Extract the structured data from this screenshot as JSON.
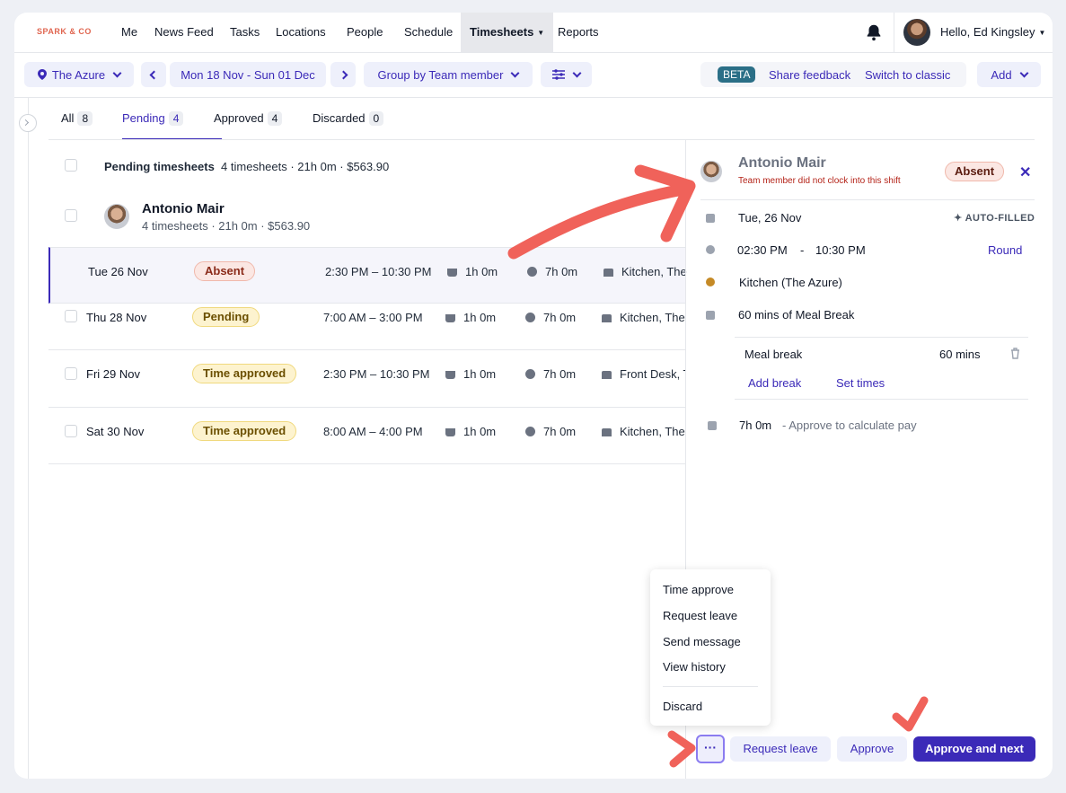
{
  "brand": "SPARK & CO",
  "nav": {
    "items": [
      "Me",
      "News Feed",
      "Tasks",
      "Locations",
      "People",
      "Schedule",
      "Timesheets",
      "Reports"
    ],
    "active": "Timesheets",
    "greeting": "Hello, Ed Kingsley"
  },
  "toolbar": {
    "location": "The Azure",
    "date_range": "Mon 18 Nov - Sun 01 Dec",
    "group_by": "Group by Team member",
    "beta": "BETA",
    "share_feedback": "Share feedback",
    "switch_classic": "Switch to classic",
    "add": "Add"
  },
  "tabs": [
    {
      "label": "All",
      "count": "8"
    },
    {
      "label": "Pending",
      "count": "4"
    },
    {
      "label": "Approved",
      "count": "4"
    },
    {
      "label": "Discarded",
      "count": "0"
    }
  ],
  "summary": {
    "title": "Pending timesheets",
    "detail": "4 timesheets · 21h 0m · $563.90"
  },
  "person": {
    "name": "Antonio Mair",
    "detail": "4 timesheets · 21h 0m · $563.90"
  },
  "rows": [
    {
      "date": "Tue 26 Nov",
      "status": "Absent",
      "time": "2:30 PM – 10:30 PM",
      "break": "1h 0m",
      "duration": "7h 0m",
      "location": "Kitchen, The"
    },
    {
      "date": "Thu 28 Nov",
      "status": "Pending",
      "time": "7:00 AM – 3:00 PM",
      "break": "1h 0m",
      "duration": "7h 0m",
      "location": "Kitchen, The"
    },
    {
      "date": "Fri 29 Nov",
      "status": "Time approved",
      "time": "2:30 PM – 10:30 PM",
      "break": "1h 0m",
      "duration": "7h 0m",
      "location": "Front Desk, T"
    },
    {
      "date": "Sat 30 Nov",
      "status": "Time approved",
      "time": "8:00 AM – 4:00 PM",
      "break": "1h 0m",
      "duration": "7h 0m",
      "location": "Kitchen, The"
    }
  ],
  "detail": {
    "name": "Antonio Mair",
    "warning": "Team member did not clock into this shift",
    "status": "Absent",
    "date": "Tue, 26 Nov",
    "auto_filled": "AUTO-FILLED",
    "start": "02:30 PM",
    "dash": "-",
    "end": "10:30 PM",
    "round": "Round",
    "location": "Kitchen (The Azure)",
    "break_summary": "60 mins of Meal Break",
    "break_name": "Meal break",
    "break_length": "60 mins",
    "add_break": "Add break",
    "set_times": "Set times",
    "total": "7h 0m",
    "pay_note": "- Approve to calculate pay"
  },
  "menu": [
    "Time approve",
    "Request leave",
    "Send message",
    "View history",
    "Discard"
  ],
  "actions": {
    "more": "···",
    "request_leave": "Request leave",
    "approve": "Approve",
    "approve_next": "Approve and next"
  },
  "colors": {
    "accent": "#3b2ab8",
    "annotation": "#f0625a"
  }
}
